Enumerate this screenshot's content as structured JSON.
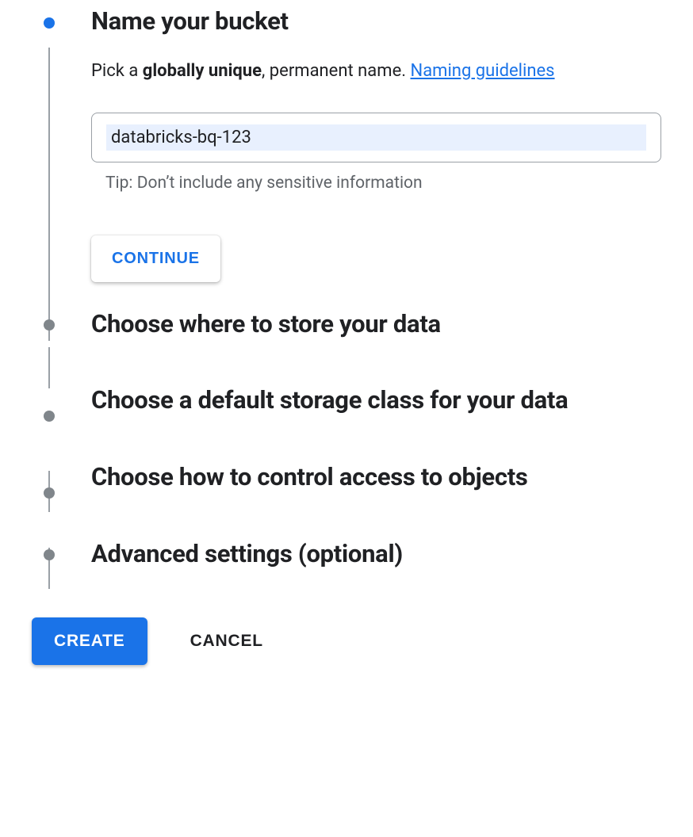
{
  "steps": {
    "name_bucket": {
      "title": "Name your bucket",
      "subtitle_prefix": "Pick a ",
      "subtitle_bold": "globally unique",
      "subtitle_suffix": ", permanent name. ",
      "link_label": "Naming guidelines",
      "input_value": "databricks-bq-123",
      "tip": "Tip: Don’t include any sensitive information",
      "continue_label": "CONTINUE"
    },
    "location": {
      "title": "Choose where to store your data"
    },
    "storage_class": {
      "title": "Choose a default storage class for your data"
    },
    "access_control": {
      "title": "Choose how to control access to objects"
    },
    "advanced": {
      "title": "Advanced settings (optional)"
    }
  },
  "footer": {
    "create_label": "CREATE",
    "cancel_label": "CANCEL"
  }
}
